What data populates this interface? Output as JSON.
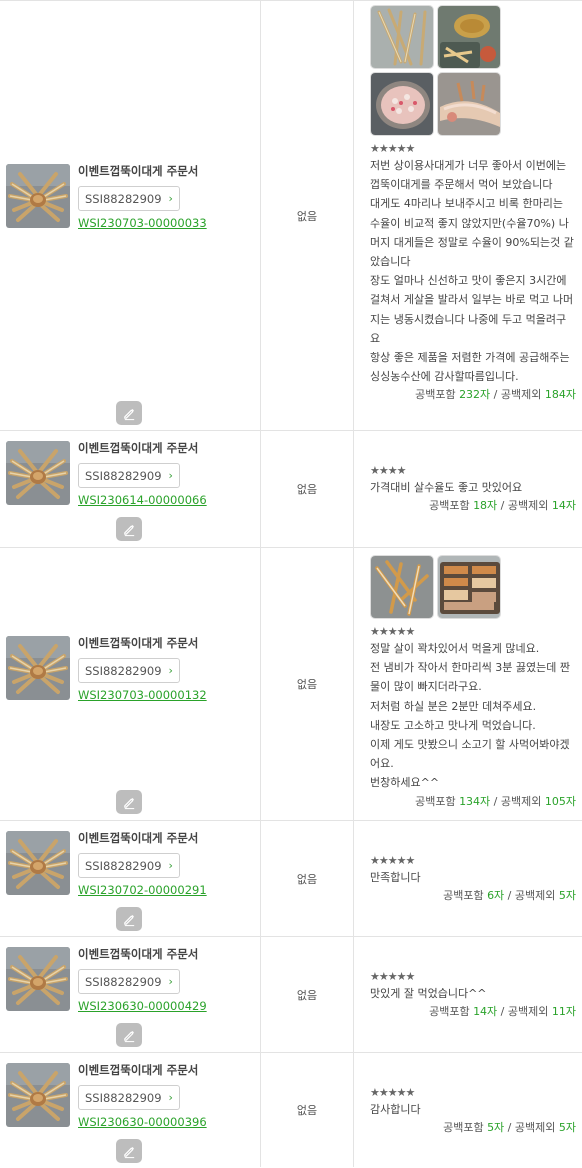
{
  "rows": [
    {
      "product_name": "이벤트껍뚝이대게 주문서",
      "product_code": "SSI88282909",
      "order_no": "WSI230703-00000033",
      "option": "없음",
      "photo_count": 4,
      "stars": "★★★★★",
      "review": "저번 상이용사대게가 너무 좋아서 이번에는 껍뚝이대게를 주문해서 먹어 보았습니다\n대게도 4마리나 보내주시고 비록 한마리는 수율이 비교적 좋지 않았지만(수율70%) 나머지 대게들은 정말로 수율이 90%되는것 같았습니다\n장도 얼마나 신선하고 맛이 좋은지 3시간에 걸쳐서 게살을 발라서 일부는 바로 먹고 나머지는 냉동시켰습니다 나중에 두고 먹을려구요\n항상 좋은 제품을 저렴한 가격에 공급해주는 싱싱농수산에 감사할따름입니다.",
      "count_with_space_label": "공백포함",
      "count_with_space": "232자",
      "count_sep": " / ",
      "count_without_space_label": "공백제외",
      "count_without_space": "184자"
    },
    {
      "product_name": "이벤트껍뚝이대게 주문서",
      "product_code": "SSI88282909",
      "order_no": "WSI230614-00000066",
      "option": "없음",
      "photo_count": 0,
      "stars": "★★★★",
      "review": "가격대비 살수율도 좋고 맛있어요",
      "count_with_space_label": "공백포함",
      "count_with_space": "18자",
      "count_sep": " / ",
      "count_without_space_label": "공백제외",
      "count_without_space": "14자"
    },
    {
      "product_name": "이벤트껍뚝이대게 주문서",
      "product_code": "SSI88282909",
      "order_no": "WSI230703-00000132",
      "option": "없음",
      "photo_count": 2,
      "stars": "★★★★★",
      "review": "정말 살이 꽉차있어서 먹을게 많네요.\n전 냄비가 작아서 한마리씩 3분 끓였는데 짠물이 많이 빠지더라구요.\n저처럼 하실 분은 2분만 데쳐주세요.\n내장도 고소하고 맛나게 먹었습니다.\n이제 게도 맛봤으니 소고기 할 사먹어봐야겠어요.\n번창하세요^^",
      "count_with_space_label": "공백포함",
      "count_with_space": "134자",
      "count_sep": " / ",
      "count_without_space_label": "공백제외",
      "count_without_space": "105자"
    },
    {
      "product_name": "이벤트껍뚝이대게 주문서",
      "product_code": "SSI88282909",
      "order_no": "WSI230702-00000291",
      "option": "없음",
      "photo_count": 0,
      "stars": "★★★★★",
      "review": "만족합니다",
      "count_with_space_label": "공백포함",
      "count_with_space": "6자",
      "count_sep": " / ",
      "count_without_space_label": "공백제외",
      "count_without_space": "5자"
    },
    {
      "product_name": "이벤트껍뚝이대게 주문서",
      "product_code": "SSI88282909",
      "order_no": "WSI230630-00000429",
      "option": "없음",
      "photo_count": 0,
      "stars": "★★★★★",
      "review": "맛있게 잘 먹었습니다^^",
      "count_with_space_label": "공백포함",
      "count_with_space": "14자",
      "count_sep": " / ",
      "count_without_space_label": "공백제외",
      "count_without_space": "11자"
    },
    {
      "product_name": "이벤트껍뚝이대게 주문서",
      "product_code": "SSI88282909",
      "order_no": "WSI230630-00000396",
      "option": "없음",
      "photo_count": 0,
      "stars": "★★★★★",
      "review": "감사합니다",
      "count_with_space_label": "공백포함",
      "count_with_space": "5자",
      "count_sep": " / ",
      "count_without_space_label": "공백제외",
      "count_without_space": "5자"
    }
  ],
  "icons": {
    "product_thumb": "snow-crab-thumbnail",
    "edit": "pencil-icon",
    "tag_chevron": "chevron-right-icon"
  },
  "colors": {
    "accent_green": "#2aa22a",
    "edit_button": "#bdbdbd",
    "border": "#e3e3e3"
  }
}
